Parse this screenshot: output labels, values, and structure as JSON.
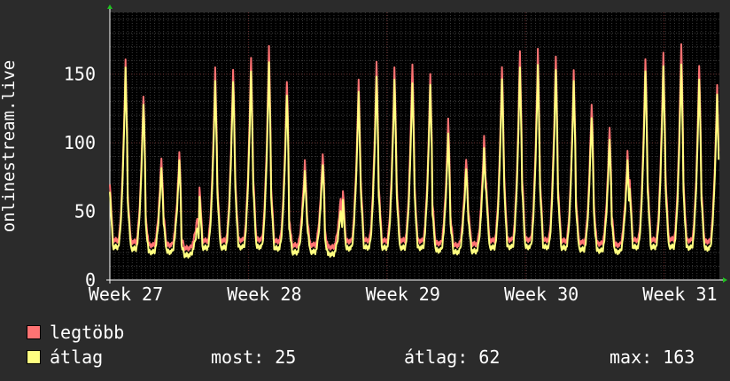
{
  "chart_data": {
    "type": "line",
    "ylabel": "onlinestream.live",
    "xlabel": "",
    "ylim": [
      0,
      195
    ],
    "yticks": [
      0,
      50,
      100,
      150
    ],
    "x_tick_labels": [
      "Week 27",
      "Week 28",
      "Week 29",
      "Week 30",
      "Week 31"
    ],
    "grid": true,
    "legend": "bottom",
    "series": [
      {
        "name": "legtöbb",
        "color": "#ff7373",
        "daily_peaks": [
          163,
          138,
          90,
          93,
          46,
          157,
          158,
          165,
          172,
          148,
          88,
          95,
          60,
          147,
          163,
          157,
          162,
          153,
          118,
          90,
          106,
          160,
          170,
          170,
          167,
          155,
          132,
          113,
          94,
          165,
          168,
          177,
          159,
          143
        ]
      },
      {
        "name": "átlag",
        "color": "#ffff80",
        "daily_peaks": [
          157,
          132,
          83,
          87,
          39,
          147,
          149,
          155,
          160,
          138,
          80,
          87,
          51,
          138,
          152,
          148,
          148,
          145,
          107,
          83,
          97,
          151,
          158,
          158,
          157,
          147,
          122,
          104,
          87,
          156,
          158,
          162,
          149,
          136
        ]
      }
    ]
  },
  "legend": {
    "items": [
      {
        "label": "legtöbb",
        "color": "#ff7373"
      },
      {
        "label": "átlag",
        "color": "#ffff80"
      }
    ],
    "stats": {
      "most": "most: 25",
      "atlag": "átlag: 62",
      "max": "max: 163"
    }
  }
}
